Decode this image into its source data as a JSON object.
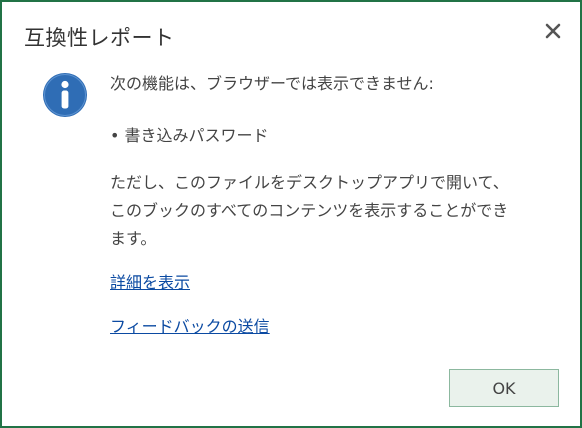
{
  "dialog": {
    "title": "互換性レポート",
    "message": "次の機能は、ブラウザーでは表示できません:",
    "features": [
      "• 書き込みパスワード"
    ],
    "note_line1": "ただし、このファイルをデスクトップアプリで開いて、",
    "note_line2": "このブックのすべてのコンテンツを表示することができ",
    "note_line3": "ます。",
    "details_link": "詳細を表示",
    "feedback_link": "フィードバックの送信",
    "ok_label": "OK"
  },
  "icons": {
    "info": "info-icon",
    "close": "close-icon"
  },
  "colors": {
    "border": "#217346",
    "info_icon": "#2f6db5",
    "link": "#0b4aa2",
    "ok_button_bg": "#eaf2ec"
  }
}
